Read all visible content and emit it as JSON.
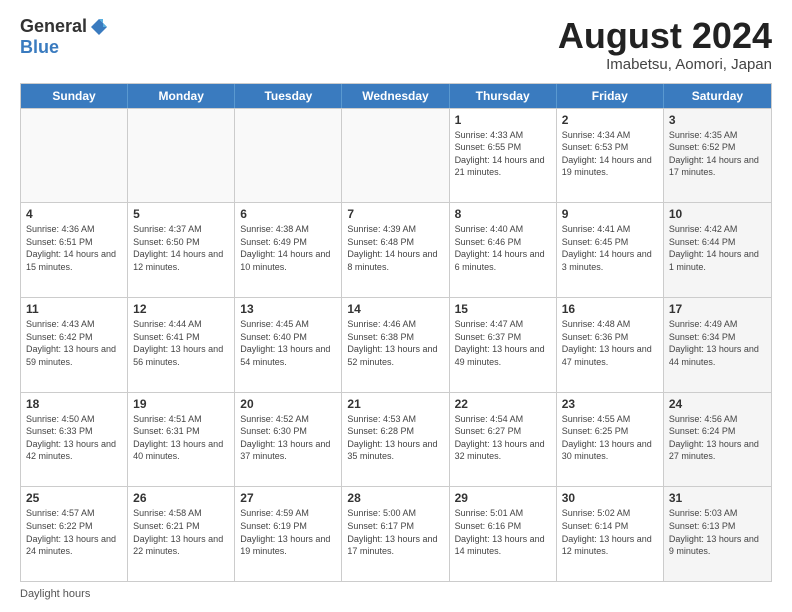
{
  "logo": {
    "general": "General",
    "blue": "Blue"
  },
  "title": "August 2024",
  "subtitle": "Imabetsu, Aomori, Japan",
  "days_of_week": [
    "Sunday",
    "Monday",
    "Tuesday",
    "Wednesday",
    "Thursday",
    "Friday",
    "Saturday"
  ],
  "footer": "Daylight hours",
  "weeks": [
    [
      {
        "day": "",
        "info": "",
        "empty": true
      },
      {
        "day": "",
        "info": "",
        "empty": true
      },
      {
        "day": "",
        "info": "",
        "empty": true
      },
      {
        "day": "",
        "info": "",
        "empty": true
      },
      {
        "day": "1",
        "info": "Sunrise: 4:33 AM\nSunset: 6:55 PM\nDaylight: 14 hours\nand 21 minutes."
      },
      {
        "day": "2",
        "info": "Sunrise: 4:34 AM\nSunset: 6:53 PM\nDaylight: 14 hours\nand 19 minutes."
      },
      {
        "day": "3",
        "info": "Sunrise: 4:35 AM\nSunset: 6:52 PM\nDaylight: 14 hours\nand 17 minutes.",
        "shaded": true
      }
    ],
    [
      {
        "day": "4",
        "info": "Sunrise: 4:36 AM\nSunset: 6:51 PM\nDaylight: 14 hours\nand 15 minutes."
      },
      {
        "day": "5",
        "info": "Sunrise: 4:37 AM\nSunset: 6:50 PM\nDaylight: 14 hours\nand 12 minutes."
      },
      {
        "day": "6",
        "info": "Sunrise: 4:38 AM\nSunset: 6:49 PM\nDaylight: 14 hours\nand 10 minutes."
      },
      {
        "day": "7",
        "info": "Sunrise: 4:39 AM\nSunset: 6:48 PM\nDaylight: 14 hours\nand 8 minutes."
      },
      {
        "day": "8",
        "info": "Sunrise: 4:40 AM\nSunset: 6:46 PM\nDaylight: 14 hours\nand 6 minutes."
      },
      {
        "day": "9",
        "info": "Sunrise: 4:41 AM\nSunset: 6:45 PM\nDaylight: 14 hours\nand 3 minutes."
      },
      {
        "day": "10",
        "info": "Sunrise: 4:42 AM\nSunset: 6:44 PM\nDaylight: 14 hours\nand 1 minute.",
        "shaded": true
      }
    ],
    [
      {
        "day": "11",
        "info": "Sunrise: 4:43 AM\nSunset: 6:42 PM\nDaylight: 13 hours\nand 59 minutes."
      },
      {
        "day": "12",
        "info": "Sunrise: 4:44 AM\nSunset: 6:41 PM\nDaylight: 13 hours\nand 56 minutes."
      },
      {
        "day": "13",
        "info": "Sunrise: 4:45 AM\nSunset: 6:40 PM\nDaylight: 13 hours\nand 54 minutes."
      },
      {
        "day": "14",
        "info": "Sunrise: 4:46 AM\nSunset: 6:38 PM\nDaylight: 13 hours\nand 52 minutes."
      },
      {
        "day": "15",
        "info": "Sunrise: 4:47 AM\nSunset: 6:37 PM\nDaylight: 13 hours\nand 49 minutes."
      },
      {
        "day": "16",
        "info": "Sunrise: 4:48 AM\nSunset: 6:36 PM\nDaylight: 13 hours\nand 47 minutes."
      },
      {
        "day": "17",
        "info": "Sunrise: 4:49 AM\nSunset: 6:34 PM\nDaylight: 13 hours\nand 44 minutes.",
        "shaded": true
      }
    ],
    [
      {
        "day": "18",
        "info": "Sunrise: 4:50 AM\nSunset: 6:33 PM\nDaylight: 13 hours\nand 42 minutes."
      },
      {
        "day": "19",
        "info": "Sunrise: 4:51 AM\nSunset: 6:31 PM\nDaylight: 13 hours\nand 40 minutes."
      },
      {
        "day": "20",
        "info": "Sunrise: 4:52 AM\nSunset: 6:30 PM\nDaylight: 13 hours\nand 37 minutes."
      },
      {
        "day": "21",
        "info": "Sunrise: 4:53 AM\nSunset: 6:28 PM\nDaylight: 13 hours\nand 35 minutes."
      },
      {
        "day": "22",
        "info": "Sunrise: 4:54 AM\nSunset: 6:27 PM\nDaylight: 13 hours\nand 32 minutes."
      },
      {
        "day": "23",
        "info": "Sunrise: 4:55 AM\nSunset: 6:25 PM\nDaylight: 13 hours\nand 30 minutes."
      },
      {
        "day": "24",
        "info": "Sunrise: 4:56 AM\nSunset: 6:24 PM\nDaylight: 13 hours\nand 27 minutes.",
        "shaded": true
      }
    ],
    [
      {
        "day": "25",
        "info": "Sunrise: 4:57 AM\nSunset: 6:22 PM\nDaylight: 13 hours\nand 24 minutes."
      },
      {
        "day": "26",
        "info": "Sunrise: 4:58 AM\nSunset: 6:21 PM\nDaylight: 13 hours\nand 22 minutes."
      },
      {
        "day": "27",
        "info": "Sunrise: 4:59 AM\nSunset: 6:19 PM\nDaylight: 13 hours\nand 19 minutes."
      },
      {
        "day": "28",
        "info": "Sunrise: 5:00 AM\nSunset: 6:17 PM\nDaylight: 13 hours\nand 17 minutes."
      },
      {
        "day": "29",
        "info": "Sunrise: 5:01 AM\nSunset: 6:16 PM\nDaylight: 13 hours\nand 14 minutes."
      },
      {
        "day": "30",
        "info": "Sunrise: 5:02 AM\nSunset: 6:14 PM\nDaylight: 13 hours\nand 12 minutes."
      },
      {
        "day": "31",
        "info": "Sunrise: 5:03 AM\nSunset: 6:13 PM\nDaylight: 13 hours\nand 9 minutes.",
        "shaded": true
      }
    ]
  ]
}
